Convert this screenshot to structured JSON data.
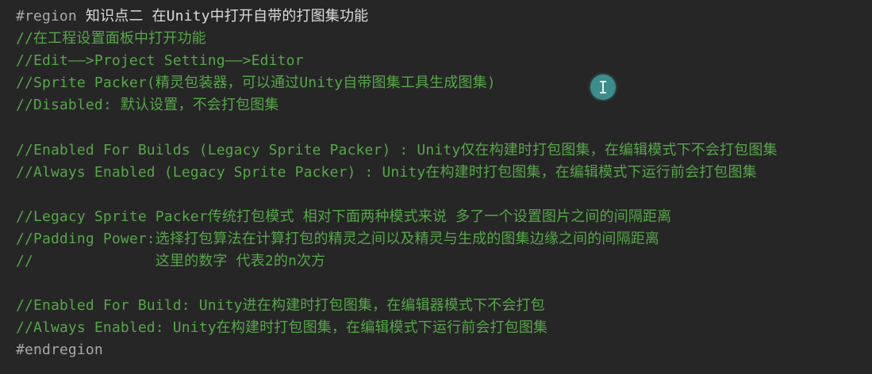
{
  "editor": {
    "region_keyword": "#region",
    "region_name": "知识点二 在Unity中打开自带的打图集功能",
    "lines": [
      "//在工程设置面板中打开功能",
      "//Edit——>Project Setting——>Editor",
      "//Sprite Packer(精灵包装器，可以通过Unity自带图集工具生成图集)",
      "//Disabled: 默认设置，不会打包图集",
      "",
      "//Enabled For Builds (Legacy Sprite Packer) : Unity仅在构建时打包图集，在编辑模式下不会打包图集",
      "//Always Enabled (Legacy Sprite Packer) : Unity在构建时打包图集，在编辑模式下运行前会打包图集",
      "",
      "//Legacy Sprite Packer传统打包模式 相对下面两种模式来说 多了一个设置图片之间的间隔距离",
      "//Padding Power:选择打包算法在计算打包的精灵之间以及精灵与生成的图集边缘之间的间隔距离",
      "//              这里的数字 代表2的n次方",
      "",
      "//Enabled For Build: Unity进在构建时打包图集，在编辑器模式下不会打包",
      "//Always Enabled: Unity在构建时打包图集，在编辑模式下运行前会打包图集"
    ],
    "endregion_keyword": "#endregion",
    "cursor_icon": "text-cursor-icon"
  },
  "colors": {
    "background": "#262626",
    "comment": "#57a64a",
    "directive": "#a9a9a9",
    "cursor_circle": "#3d8c8c"
  }
}
